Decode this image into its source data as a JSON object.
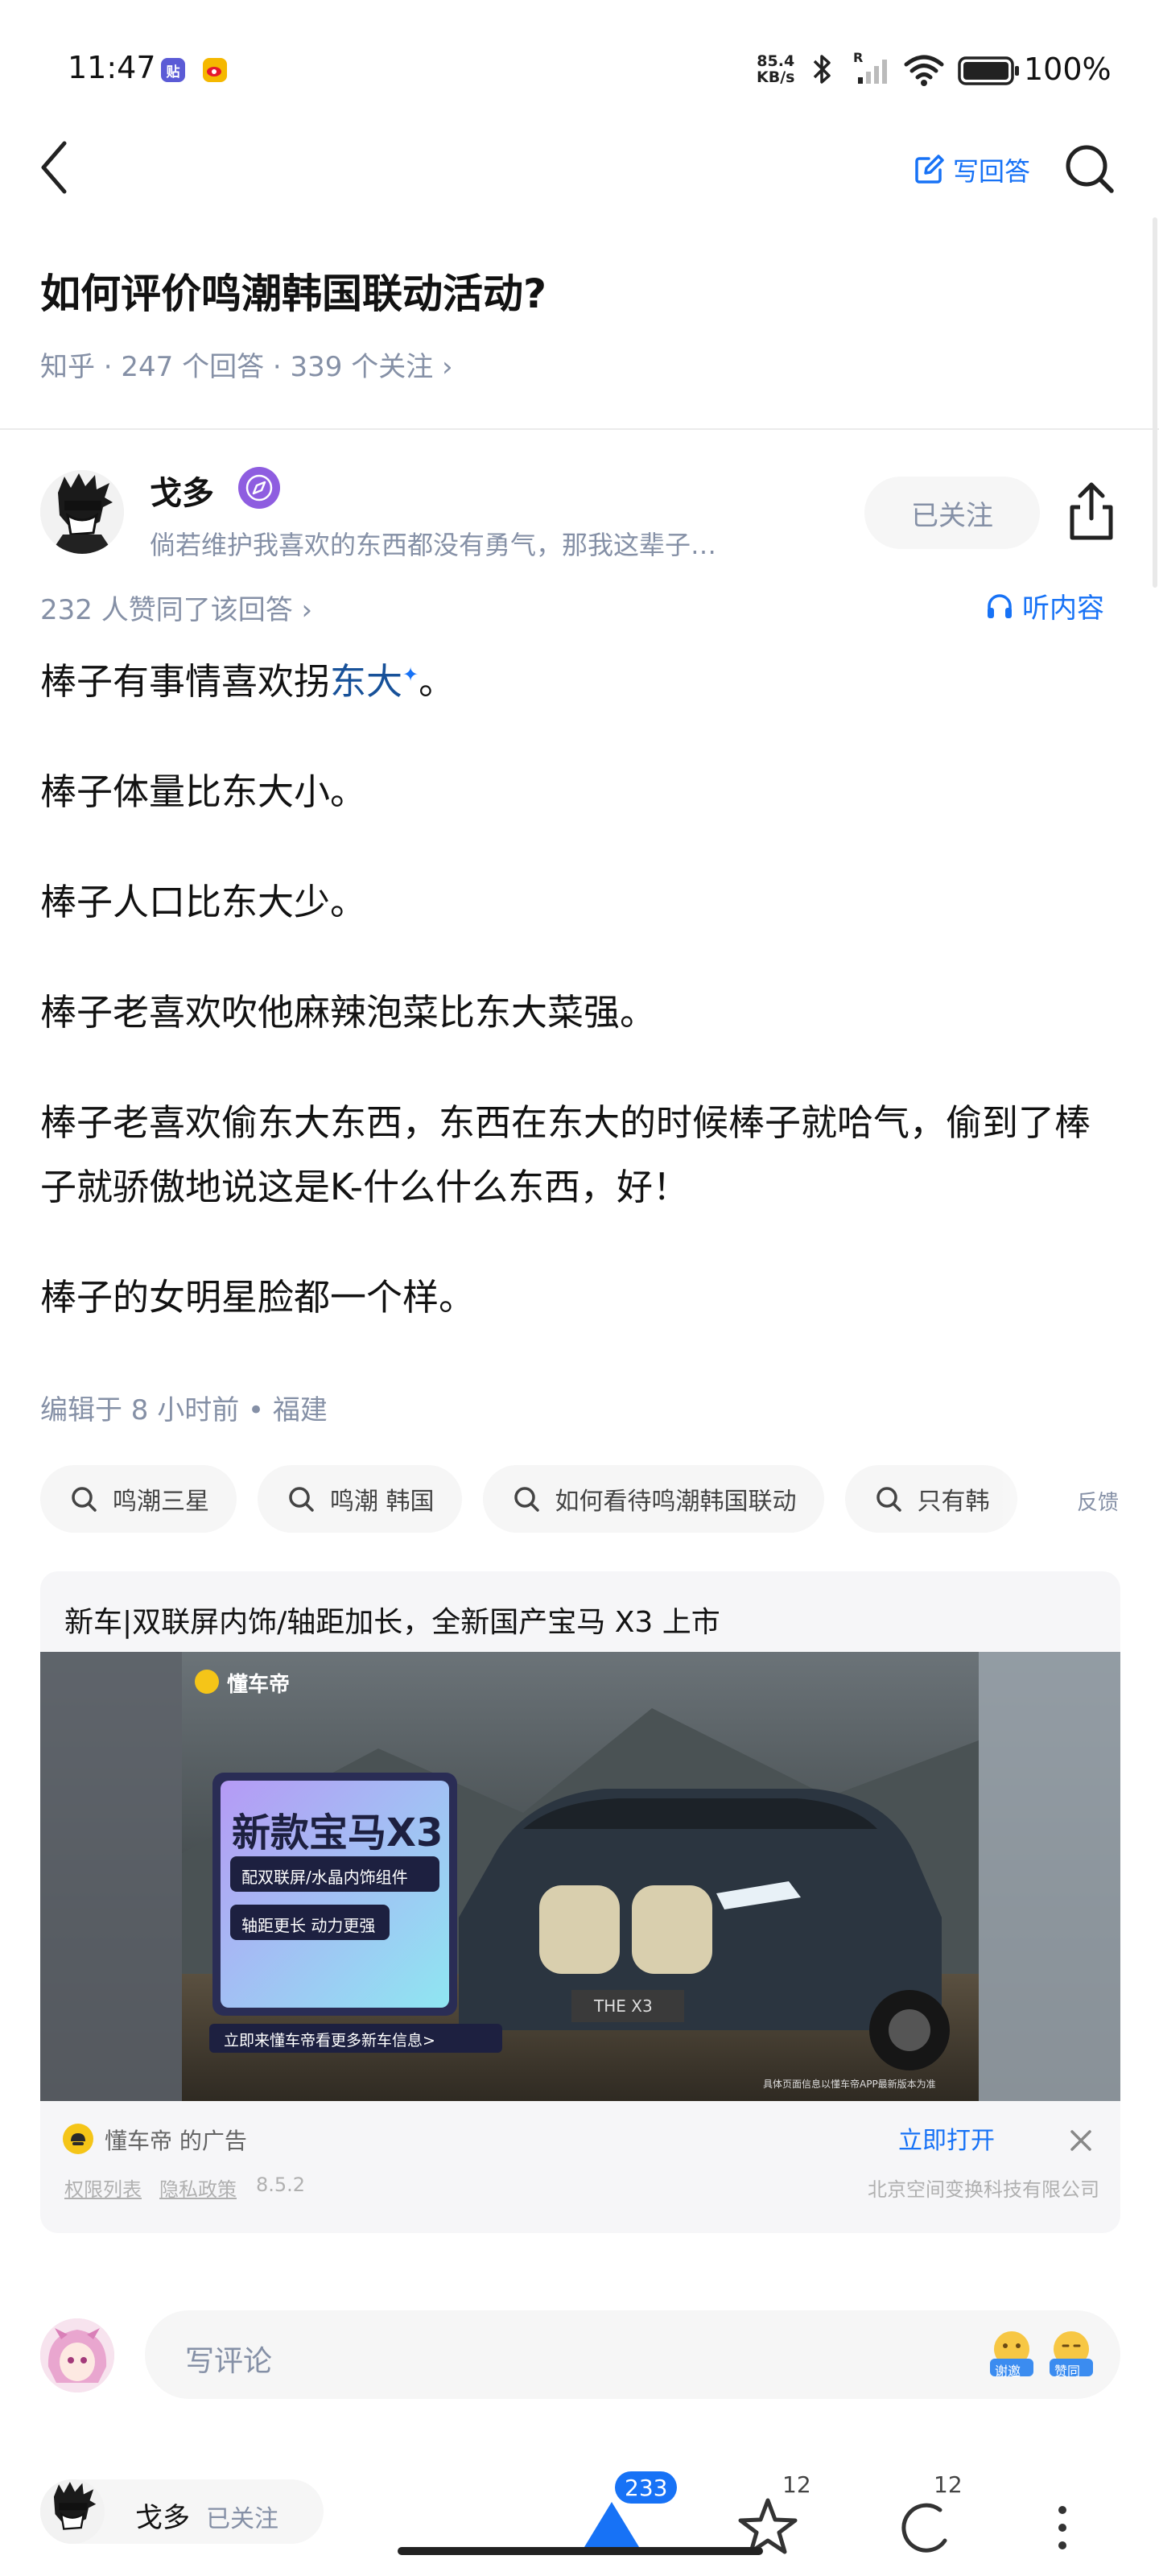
{
  "status_bar": {
    "time": "11:47",
    "app_badge_1": "贴",
    "net_speed_value": "85.4",
    "net_speed_unit": "KB/s",
    "signal_label": "R",
    "battery": "100%"
  },
  "header": {
    "write_answer": "写回答"
  },
  "question": {
    "title": "如何评价鸣潮韩国联动活动?",
    "meta": "知乎 · 247 个回答 · 339 个关注 ›"
  },
  "author": {
    "name": "戈多",
    "bio": "倘若维护我喜欢的东西都没有勇气，那我这辈子…",
    "follow_label": "已关注"
  },
  "answer": {
    "upvote_meta": "232 人赞同了该回答 ›",
    "listen_label": "听内容",
    "p1_prefix": "棒子有事情喜欢拐",
    "p1_link": "东大",
    "p1_star": "✦",
    "p1_suffix": "。",
    "p2": "棒子体量比东大小。",
    "p3": "棒子人口比东大少。",
    "p4": "棒子老喜欢吹他麻辣泡菜比东大菜强。",
    "p5": "棒子老喜欢偷东大东西，东西在东大的时候棒子就哈气，偷到了棒子就骄傲地说这是K-什么什么东西，好！",
    "p6": "棒子的女明星脸都一个样。",
    "edit_meta": "编辑于 8 小时前 • 福建"
  },
  "search_chips": [
    "鸣潮三星",
    "鸣潮 韩国",
    "如何看待鸣潮韩国联动",
    "只有韩"
  ],
  "feedback_label": "反馈",
  "ad": {
    "title": "新车|双联屏内饰/轴距加长，全新国产宝马 X3 上市",
    "brand_logo_text": "懂车帝",
    "headline": "新款宝马X3",
    "feature_1": "配双联屏/水晶内饰组件",
    "feature_2": "轴距更长 动力更强",
    "cta_strip": "立即来懂车帝看更多新车信息>",
    "plate": "THE X3",
    "disclaimer": "具体页面信息以懂车帝APP最新版本为准",
    "sponsor": "懂车帝 的广告",
    "open_label": "立即打开",
    "permissions": "权限列表",
    "privacy": "隐私政策",
    "version": "8.5.2",
    "company": "北京空间变换科技有限公司"
  },
  "comment": {
    "placeholder": "写评论",
    "emoji_1": "谢邀",
    "emoji_2": "赞同"
  },
  "bottom_bar": {
    "author_name": "戈多",
    "followed": "已关注",
    "upvote_count": "233",
    "star_count": "12",
    "comment_count": "12"
  },
  "colors": {
    "accent": "#1772f6",
    "text_primary": "#121212",
    "text_secondary": "#8590a6"
  }
}
